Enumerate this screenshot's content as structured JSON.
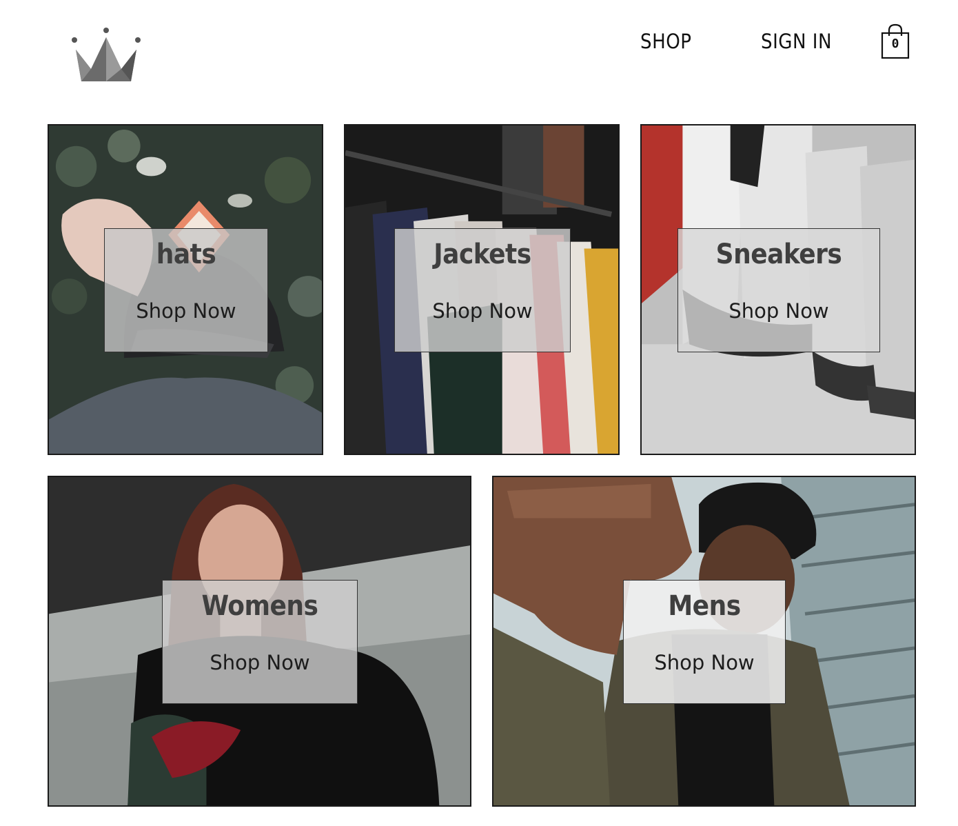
{
  "header": {
    "logo_icon": "crown-icon",
    "nav": {
      "shop_label": "SHOP",
      "signin_label": "SIGN IN"
    },
    "cart": {
      "icon": "shopping-bag-icon",
      "count": "0"
    }
  },
  "categories": [
    {
      "title": "hats",
      "cta": "Shop Now",
      "image": "man wearing black cap"
    },
    {
      "title": "Jackets",
      "cta": "Shop Now",
      "image": "jackets on clothing rack"
    },
    {
      "title": "Sneakers",
      "cta": "Shop Now",
      "image": "row of sneakers"
    },
    {
      "title": "Womens",
      "cta": "Shop Now",
      "image": "woman in black top"
    },
    {
      "title": "Mens",
      "cta": "Shop Now",
      "image": "man reaching toward camera"
    }
  ],
  "colors": {
    "text": "#111111",
    "title_gray": "#3f3f3f",
    "border": "#1a1a1a",
    "logo_gray": "#6e6e6e"
  }
}
